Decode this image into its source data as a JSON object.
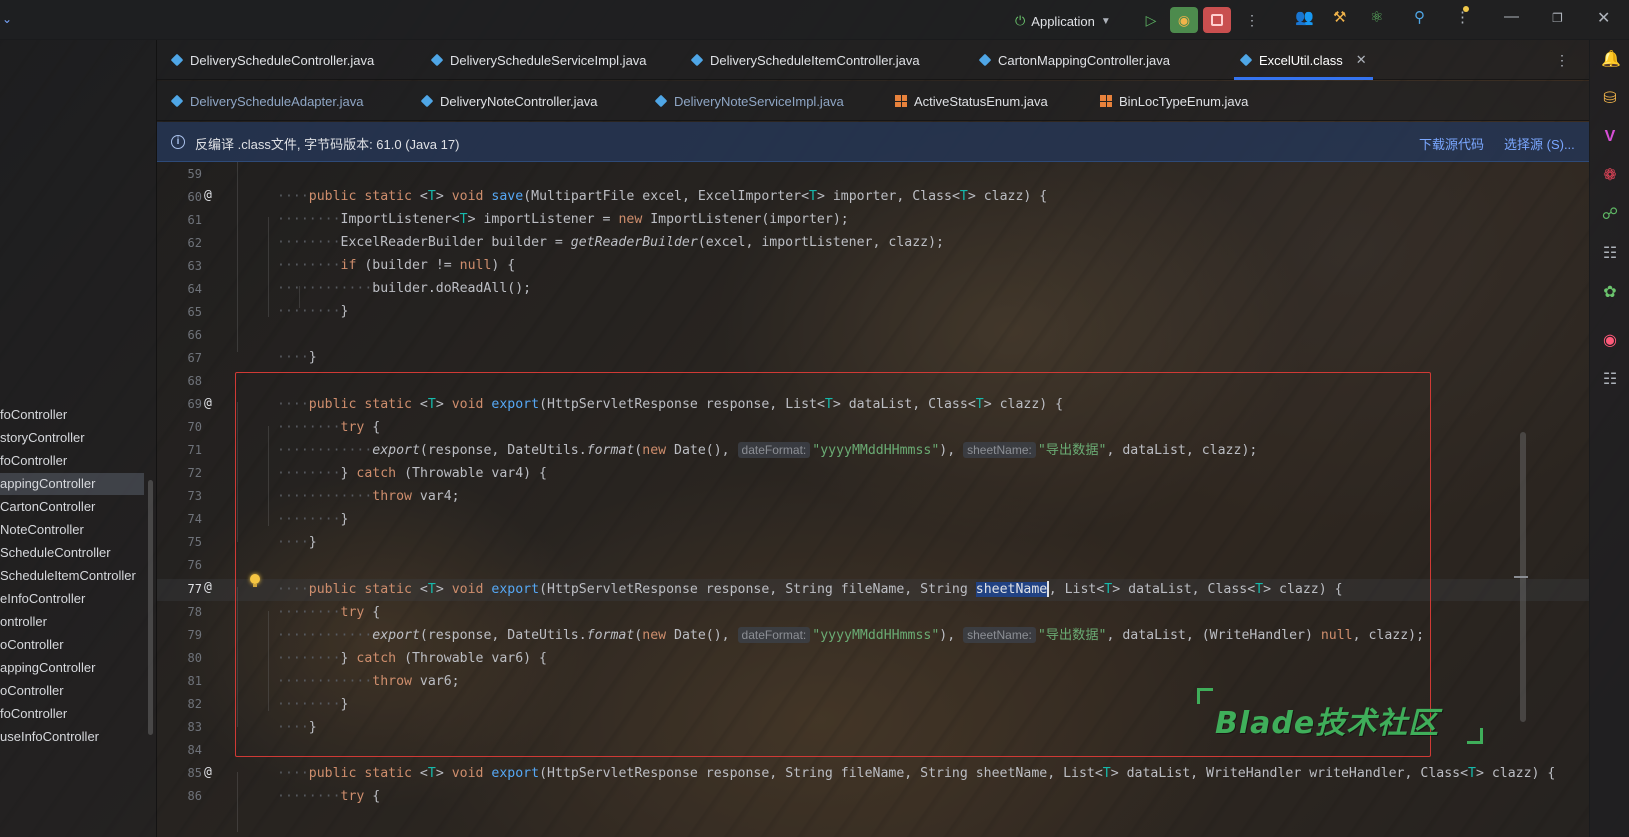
{
  "titlebar": {
    "run_config": "Application"
  },
  "project_panel": {
    "items": [
      {
        "label": "foController",
        "selected": false
      },
      {
        "label": "storyController",
        "selected": false
      },
      {
        "label": "foController",
        "selected": false
      },
      {
        "label": "appingController",
        "selected": true
      },
      {
        "label": "CartonController",
        "selected": false
      },
      {
        "label": "NoteController",
        "selected": false
      },
      {
        "label": "ScheduleController",
        "selected": false
      },
      {
        "label": "ScheduleItemController",
        "selected": false
      },
      {
        "label": "eInfoController",
        "selected": false
      },
      {
        "label": "ontroller",
        "selected": false
      },
      {
        "label": "oController",
        "selected": false
      },
      {
        "label": "appingController",
        "selected": false
      },
      {
        "label": "oController",
        "selected": false
      },
      {
        "label": "foController",
        "selected": false
      },
      {
        "label": "useInfoController",
        "selected": false
      }
    ]
  },
  "tabs_row1": [
    {
      "label": "DeliveryScheduleController.java",
      "icon": "class-icon"
    },
    {
      "label": "DeliveryScheduleServiceImpl.java",
      "icon": "class-icon"
    },
    {
      "label": "DeliveryScheduleItemController.java",
      "icon": "class-icon"
    },
    {
      "label": "CartonMappingController.java",
      "icon": "class-icon"
    },
    {
      "label": "ExcelUtil.class",
      "icon": "class-icon",
      "active": true
    }
  ],
  "tabs_row2": [
    {
      "label": "DeliveryScheduleAdapter.java",
      "icon": "class-icon"
    },
    {
      "label": "DeliveryNoteController.java",
      "icon": "class-icon"
    },
    {
      "label": "DeliveryNoteServiceImpl.java",
      "icon": "class-icon"
    },
    {
      "label": "ActiveStatusEnum.java",
      "icon": "enum-icon"
    },
    {
      "label": "BinLocTypeEnum.java",
      "icon": "enum-icon"
    }
  ],
  "notice": {
    "message": "反编译 .class文件, 字节码版本: 61.0 (Java 17)",
    "download_link": "下载源代码",
    "choose_link": "选择源 (S)..."
  },
  "editor": {
    "line_numbers": [
      "59",
      "60",
      "61",
      "62",
      "63",
      "64",
      "65",
      "66",
      "67",
      "68",
      "69",
      "70",
      "71",
      "72",
      "73",
      "74",
      "75",
      "76",
      "77",
      "78",
      "79",
      "80",
      "81",
      "82",
      "83",
      "84",
      "85",
      "86"
    ],
    "current_line": "77",
    "hints": {
      "date_format": "dateFormat:",
      "sheet_name": "sheetName:"
    },
    "strings": {
      "pattern": "\"yyyyMMddHHmmss\"",
      "export_name": "\"导出数据\""
    }
  },
  "watermark": "Blade技术社区",
  "colors": {
    "keyword": "#cf8e6d",
    "method": "#56a8f5",
    "string": "#6aab73",
    "generic": "#16baac",
    "highlight_box": "#d03a35",
    "accent": "#3574f0"
  }
}
